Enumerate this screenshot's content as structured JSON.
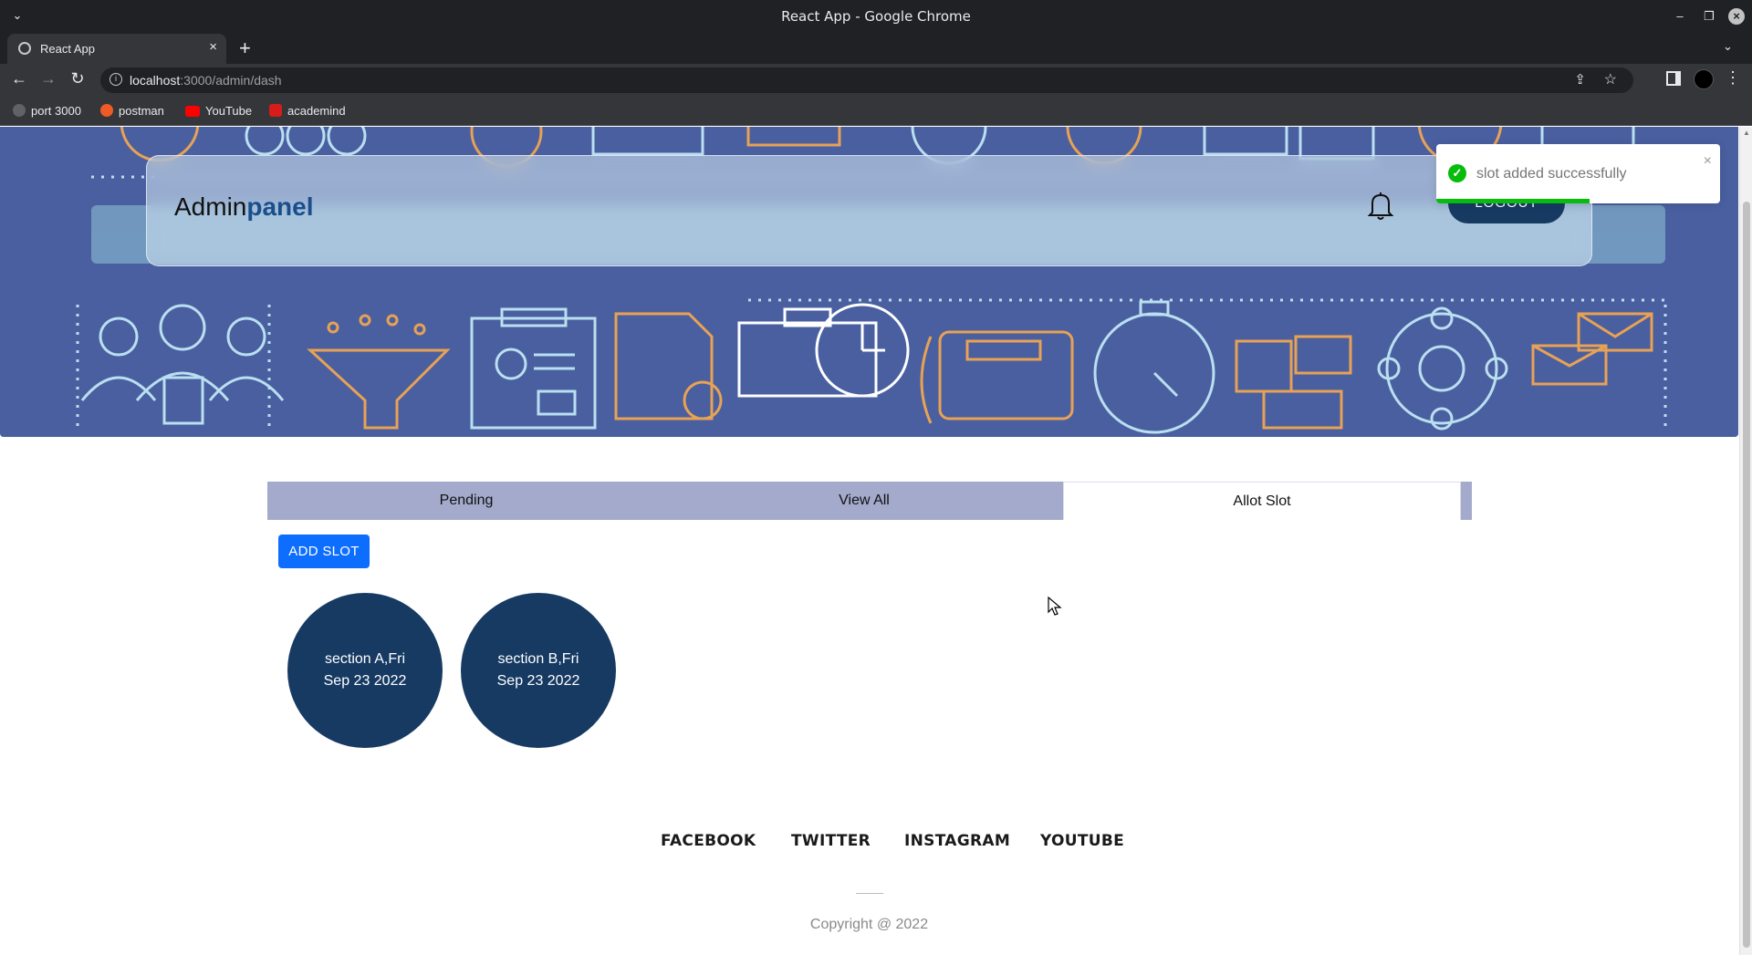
{
  "window": {
    "title": "React App - Google Chrome",
    "menu_icon": "chevron-down-icon",
    "minimize_icon": "minimize-icon",
    "maximize_icon": "restore-icon",
    "close_icon": "close-icon"
  },
  "tabs": [
    {
      "title": "React App",
      "close": "×"
    }
  ],
  "new_tab": "+",
  "address": {
    "host": "localhost",
    "path": ":3000/admin/dash"
  },
  "bookmarks": [
    {
      "label": "port 3000"
    },
    {
      "label": "postman"
    },
    {
      "label": "YouTube"
    },
    {
      "label": "academind"
    }
  ],
  "navbar": {
    "brand_prefix": "Admin",
    "brand_accent": "panel",
    "logout_label": "LOGOUT"
  },
  "toast": {
    "message": "slot added successfully",
    "close": "×",
    "progress_fraction": 0.54
  },
  "page_tabs": [
    {
      "label": "Pending",
      "active": false
    },
    {
      "label": "View All",
      "active": false
    },
    {
      "label": "Allot Slot",
      "active": true
    }
  ],
  "add_slot_label": "ADD SLOT",
  "slots": [
    {
      "label": "section A,Fri Sep 23 2022"
    },
    {
      "label": "section B,Fri Sep 23 2022"
    }
  ],
  "footer": {
    "links": [
      "FACEBOOK",
      "TWITTER",
      "INSTAGRAM",
      "YOUTUBE"
    ],
    "copyright": "Copyright @ 2022"
  },
  "colors": {
    "banner_bg": "#4a5fa0",
    "navy": "#173a63",
    "tab_bar": "#a3aacc",
    "primary_button": "#0d6efd",
    "toast_success": "#07bc0c"
  }
}
